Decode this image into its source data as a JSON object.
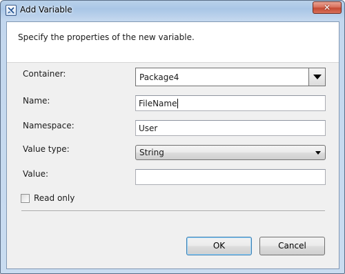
{
  "window": {
    "title": "Add Variable",
    "close_glyph": "✕"
  },
  "header": {
    "text": "Specify the properties of the new variable."
  },
  "fields": {
    "container_label": "Container:",
    "container_value": "Package4",
    "name_label": "Name:",
    "name_value": "FileName",
    "namespace_label": "Namespace:",
    "namespace_value": "User",
    "value_type_label": "Value type:",
    "value_type_value": "String",
    "value_label": "Value:",
    "value_value": ""
  },
  "options": {
    "read_only_label": "Read only",
    "read_only_checked": false
  },
  "buttons": {
    "ok_label": "OK",
    "cancel_label": "Cancel"
  },
  "colors": {
    "title_gradient_top": "#b9d1ea",
    "client_background": "#f0f0f0",
    "close_button": "#c44a33",
    "default_button_border": "#3c7fb1"
  },
  "icons": {
    "app_icon": "variable-icon",
    "close": "close-icon",
    "container_dropdown": "chevron-down-icon",
    "value_type_dropdown": "chevron-down-icon"
  }
}
